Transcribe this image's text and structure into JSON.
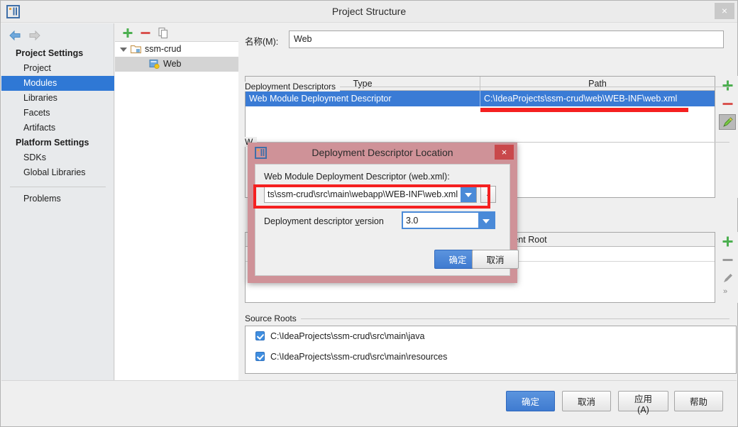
{
  "window": {
    "title": "Project Structure",
    "close_label": "×",
    "logo_icon": "intellij-idea-logo-icon"
  },
  "sidebar": {
    "back_icon": "arrow-left-icon",
    "forward_icon": "arrow-right-icon",
    "groups": [
      {
        "header": "Project Settings",
        "items": [
          {
            "label": "Project",
            "selected": false
          },
          {
            "label": "Modules",
            "selected": true
          },
          {
            "label": "Libraries",
            "selected": false
          },
          {
            "label": "Facets",
            "selected": false
          },
          {
            "label": "Artifacts",
            "selected": false
          }
        ]
      },
      {
        "header": "Platform Settings",
        "items": [
          {
            "label": "SDKs",
            "selected": false
          },
          {
            "label": "Global Libraries",
            "selected": false
          }
        ]
      }
    ],
    "problems_label": "Problems"
  },
  "tree": {
    "toolbar": [
      {
        "name": "add-module-button",
        "icon": "plus-icon",
        "label": "+"
      },
      {
        "name": "remove-module-button",
        "icon": "minus-icon",
        "label": "−"
      },
      {
        "name": "copy-module-button",
        "icon": "copy-icon",
        "label": ""
      }
    ],
    "rows": [
      {
        "label": "ssm-crud",
        "icon": "folder-module-icon",
        "depth": 0,
        "expanded": true,
        "selected": false
      },
      {
        "label": "Web",
        "icon": "web-facet-icon",
        "depth": 1,
        "expanded": false,
        "selected": true
      }
    ]
  },
  "main": {
    "name_label": "名称(M):",
    "name_value": "Web",
    "deployment_descriptors": {
      "group_title": "Deployment Descriptors",
      "columns": [
        "Type",
        "Path"
      ],
      "rows": [
        {
          "type": "Web Module Deployment Descriptor",
          "path": "C:\\IdeaProjects\\ssm-crud\\web\\WEB-INF\\web.xml",
          "selected": true
        }
      ],
      "tools": [
        {
          "name": "add-descriptor-button",
          "icon": "plus-icon",
          "label": "+",
          "active": false
        },
        {
          "name": "remove-descriptor-button",
          "icon": "minus-icon",
          "label": "−",
          "active": false
        },
        {
          "name": "edit-descriptor-button",
          "icon": "pencil-icon",
          "label": "",
          "active": true
        }
      ]
    },
    "web_resource_directories": {
      "group_title_partial": "W",
      "columns": [
        "Path Relative to Deployment Root"
      ],
      "rows": [],
      "tools": [
        {
          "name": "add-web-resource-button",
          "icon": "plus-icon",
          "label": "+",
          "active": false
        },
        {
          "name": "remove-web-resource-button",
          "icon": "minus-icon",
          "label": "−",
          "active": false
        },
        {
          "name": "edit-web-resource-button",
          "icon": "pencil-icon",
          "label": "",
          "active": false
        },
        {
          "name": "expand-web-resource-button",
          "icon": "chevron-double-right-icon",
          "label": "»",
          "active": false
        }
      ]
    },
    "source_roots": {
      "group_title": "Source Roots",
      "items": [
        {
          "label": "C:\\IdeaProjects\\ssm-crud\\src\\main\\java",
          "checked": true
        },
        {
          "label": "C:\\IdeaProjects\\ssm-crud\\src\\main\\resources",
          "checked": true
        }
      ]
    }
  },
  "footer": {
    "buttons": [
      {
        "name": "ok-button",
        "label": "确定",
        "primary": true
      },
      {
        "name": "cancel-button",
        "label": "取消",
        "primary": false
      },
      {
        "name": "apply-button",
        "label": "应用 (A)",
        "primary": false,
        "mnemonic": "A"
      },
      {
        "name": "help-button",
        "label": "帮助",
        "primary": false
      }
    ]
  },
  "modal": {
    "title": "Deployment Descriptor Location",
    "close_label": "×",
    "logo_icon": "intellij-idea-logo-icon",
    "descriptor_label": "Web Module Deployment Descriptor (web.xml):",
    "descriptor_value": "ts\\ssm-crud\\src\\main\\webapp\\WEB-INF\\web.xml",
    "browse_label": "..",
    "version_label_prefix": "Deployment descriptor ",
    "version_label_mnemonic": "v",
    "version_label_suffix": "ersion",
    "version_value": "3.0",
    "ok_label": "确定",
    "cancel_label": "取消"
  },
  "annotations": {
    "color": "#f52020",
    "underline_on_selected_path": true,
    "rect_on_descriptor_combo": true
  }
}
